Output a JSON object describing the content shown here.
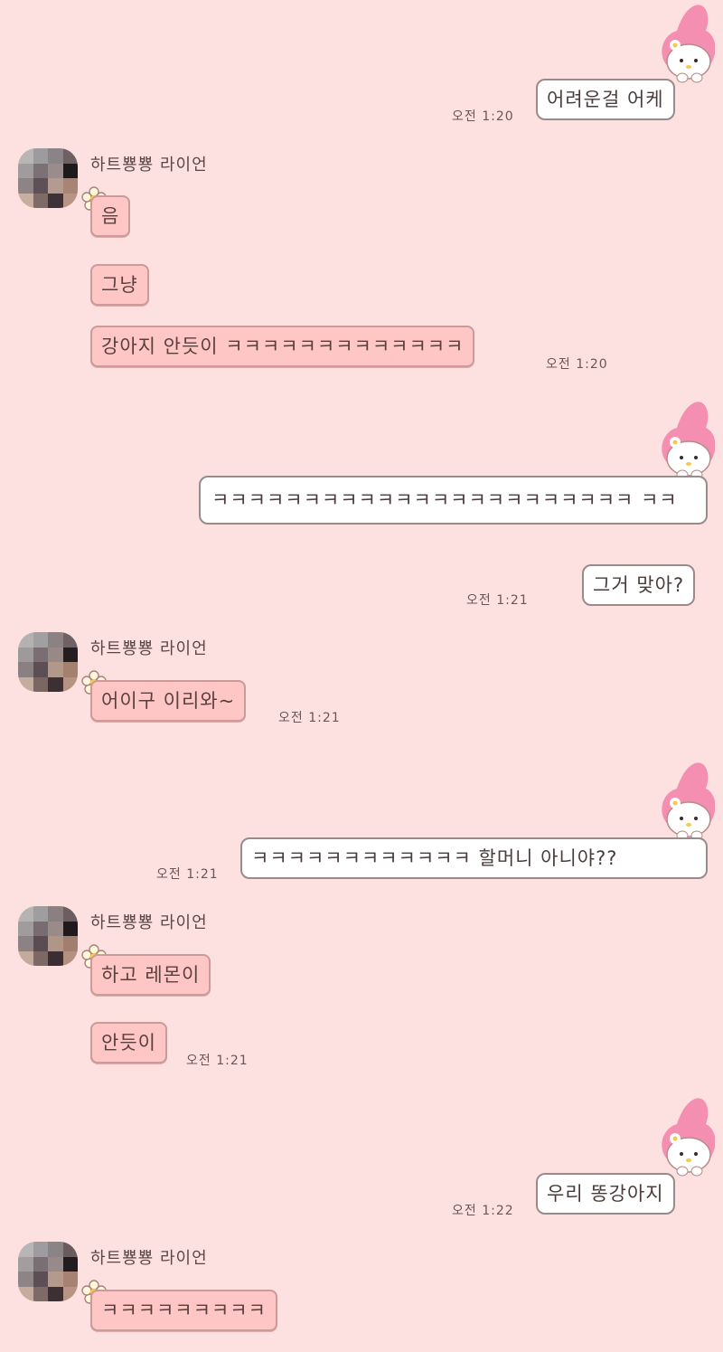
{
  "contact": {
    "name": "하트뿅뿅 라이언"
  },
  "messages": {
    "m1": {
      "text": "어려운걸 어케",
      "time": "오전 1:20"
    },
    "t1": {
      "text": "음"
    },
    "t2": {
      "text": "그냥"
    },
    "t3": {
      "text": "강아지 안듯이 ㅋㅋㅋㅋㅋㅋㅋㅋㅋㅋㅋㅋㅋ",
      "time": "오전 1:20"
    },
    "m2": {
      "text": "ㅋㅋㅋㅋㅋㅋㅋㅋㅋㅋㅋㅋㅋㅋㅋㅋㅋㅋㅋㅋㅋㅋㅋ ㅋㅋ"
    },
    "m3": {
      "text": "그거 맞아?",
      "time": "오전 1:21"
    },
    "t4": {
      "text": "어이구 이리와~",
      "time": "오전 1:21"
    },
    "m4": {
      "text": "ㅋㅋㅋㅋㅋㅋㅋㅋㅋㅋㅋㅋ 할머니 아니야??",
      "time": "오전 1:21"
    },
    "t5": {
      "text": "하고 레몬이"
    },
    "t6": {
      "text": "안듯이",
      "time": "오전 1:21"
    },
    "m5": {
      "text": "우리 똥강아지",
      "time": "오전 1:22"
    },
    "t7": {
      "text": "ㅋㅋㅋㅋㅋㅋㅋㅋㅋ"
    }
  },
  "icons": {
    "flower": "flower-icon",
    "sticker": "my-melody-sticker",
    "avatar": "contact-avatar"
  },
  "colors": {
    "background": "#fde1e1",
    "their_bubble": "#ffc6c6",
    "my_bubble": "#ffffff",
    "melody_pink": "#f58fb1"
  }
}
